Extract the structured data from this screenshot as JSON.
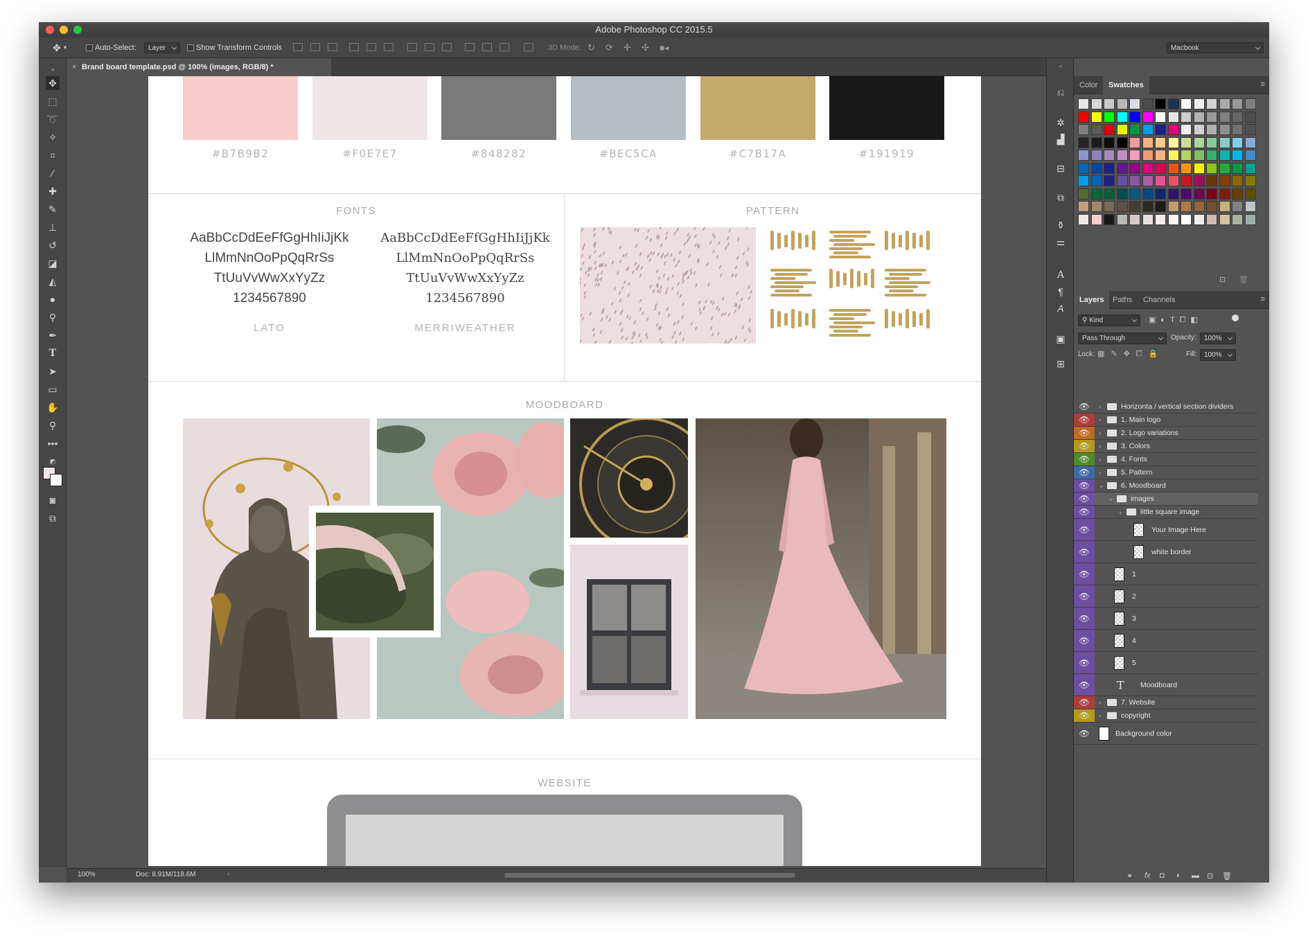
{
  "window": {
    "title": "Adobe Photoshop CC 2015.5"
  },
  "options_bar": {
    "auto_select_label": "Auto-Select:",
    "auto_select_value": "Layer",
    "show_transform_label": "Show Transform Controls",
    "mode_3d_label": "3D Mode:",
    "workspace_value": "Macbook"
  },
  "document_tab": {
    "title": "Brand board template.psd @ 100% (images, RGB/8) *",
    "close_icon": "close-icon"
  },
  "status": {
    "zoom": "100%",
    "doc_size": "Doc: 8.91M/118.6M"
  },
  "canvas": {
    "swatches": [
      {
        "hex": "#B7B9B2",
        "color": "#f9cccb"
      },
      {
        "hex": "#F0E7E7",
        "color": "#efe7e7"
      },
      {
        "hex": "#848282",
        "color": "#7b7a7a"
      },
      {
        "hex": "#BEC5CA",
        "color": "#b6bdc2"
      },
      {
        "hex": "#C7B17A",
        "color": "#c4aa6a"
      },
      {
        "hex": "#191919",
        "color": "#181818"
      }
    ],
    "fonts_header": "FONTS",
    "font_sample_1": "AaBbCcDdEeFfGgHhIiJjKk",
    "font_sample_2": "LlMmNnOoPpQqRrSs",
    "font_sample_3": "TtUuVvWwXxYyZz",
    "font_sample_4": "1234567890",
    "font_1_name": "LATO",
    "font_2_name": "MERRIWEATHER",
    "pattern_header": "PATTERN",
    "moodboard_header": "MOODBOARD",
    "website_header": "WEBSITE"
  },
  "panels": {
    "top_tabs": [
      "Color",
      "Swatches"
    ],
    "layers_tabs": [
      "Layers",
      "Paths",
      "Channels"
    ],
    "kind_filter": "Kind",
    "blend_mode": "Pass Through",
    "opacity_label": "Opacity:",
    "opacity_value": "100%",
    "lock_label": "Lock:",
    "fill_label": "Fill:",
    "fill_value": "100%",
    "layers": [
      {
        "name": "Horizonta / vertical section dividers",
        "tag": "#535353",
        "type": "group"
      },
      {
        "name": "1. Main logo",
        "tag": "#b13a3a",
        "type": "group"
      },
      {
        "name": "2. Logo variations",
        "tag": "#c06a23",
        "type": "group"
      },
      {
        "name": "3. Colors",
        "tag": "#b59a1b",
        "type": "group"
      },
      {
        "name": "4. Fonts",
        "tag": "#4d8a2d",
        "type": "group"
      },
      {
        "name": "5. Pattern",
        "tag": "#3e6aa8",
        "type": "group"
      },
      {
        "name": "6. Moodboard",
        "tag": "#6d4ea0",
        "type": "group-open"
      },
      {
        "name": "images",
        "tag": "#6d4ea0",
        "type": "group-open"
      },
      {
        "name": "little square image",
        "tag": "#6d4ea0",
        "type": "group-open"
      },
      {
        "name": "Your Image Here",
        "tag": "#6d4ea0",
        "type": "pixel"
      },
      {
        "name": "white border",
        "tag": "#6d4ea0",
        "type": "pixel"
      },
      {
        "name": "1",
        "tag": "#6d4ea0",
        "type": "pixel"
      },
      {
        "name": "2",
        "tag": "#6d4ea0",
        "type": "pixel"
      },
      {
        "name": "3",
        "tag": "#6d4ea0",
        "type": "pixel"
      },
      {
        "name": "4",
        "tag": "#6d4ea0",
        "type": "pixel"
      },
      {
        "name": "5",
        "tag": "#6d4ea0",
        "type": "pixel"
      },
      {
        "name": "Moodboard",
        "tag": "#6d4ea0",
        "type": "text"
      },
      {
        "name": "7. Website",
        "tag": "#b13a3a",
        "type": "group"
      },
      {
        "name": "copyright",
        "tag": "#b59a1b",
        "type": "group"
      },
      {
        "name": "Background color",
        "tag": "#535353",
        "type": "fill"
      }
    ]
  }
}
